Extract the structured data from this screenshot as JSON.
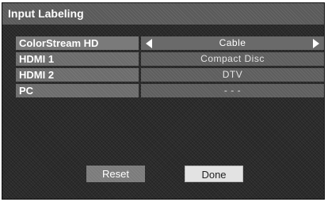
{
  "title": "Input Labeling",
  "rows": [
    {
      "input": "ColorStream HD",
      "label": "Cable",
      "selected": true
    },
    {
      "input": "HDMI 1",
      "label": "Compact Disc",
      "selected": false
    },
    {
      "input": "HDMI 2",
      "label": "DTV",
      "selected": false
    },
    {
      "input": "PC",
      "label": "- - -",
      "selected": false
    }
  ],
  "buttons": {
    "reset": "Reset",
    "done": "Done"
  },
  "colors": {
    "panel": "#2b2b2b",
    "title_bar": "#5a5a5a",
    "done_button": "#e3e3e3"
  },
  "icons": {
    "prev": "left-arrow-icon",
    "next": "right-arrow-icon"
  }
}
